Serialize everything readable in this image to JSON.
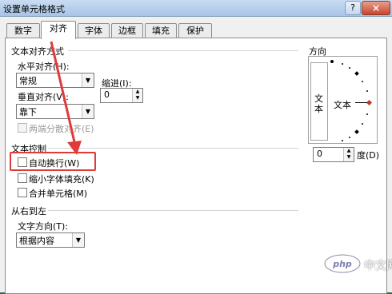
{
  "window": {
    "title": "设置单元格格式",
    "help_label": "?",
    "close_label": "×"
  },
  "tabs": [
    {
      "label": "数字"
    },
    {
      "label": "对齐"
    },
    {
      "label": "字体"
    },
    {
      "label": "边框"
    },
    {
      "label": "填充"
    },
    {
      "label": "保护"
    }
  ],
  "text_alignment": {
    "heading": "文本对齐方式",
    "horizontal_label": "水平对齐(H):",
    "horizontal_value": "常规",
    "indent_label": "缩进(I):",
    "indent_value": "0",
    "vertical_label": "垂直对齐(V):",
    "vertical_value": "靠下",
    "justify_distributed_label": "两端分散对齐(E)"
  },
  "text_control": {
    "heading": "文本控制",
    "wrap_text_label": "自动换行(W)",
    "shrink_to_fit_label": "缩小字体填充(K)",
    "merge_cells_label": "合并单元格(M)"
  },
  "rtl": {
    "heading": "从右到左",
    "direction_label": "文字方向(T):",
    "direction_value": "根据内容"
  },
  "orientation": {
    "heading": "方向",
    "vertical_text": "文本",
    "horizontal_text": "文本",
    "degrees_value": "0",
    "degrees_label": "度(D)"
  },
  "watermark": {
    "text": "中文网",
    "brand": "php"
  },
  "colors": {
    "highlight": "#e03a3a",
    "arrow": "#e03a3a",
    "accent_diamond": "#c0392b"
  }
}
